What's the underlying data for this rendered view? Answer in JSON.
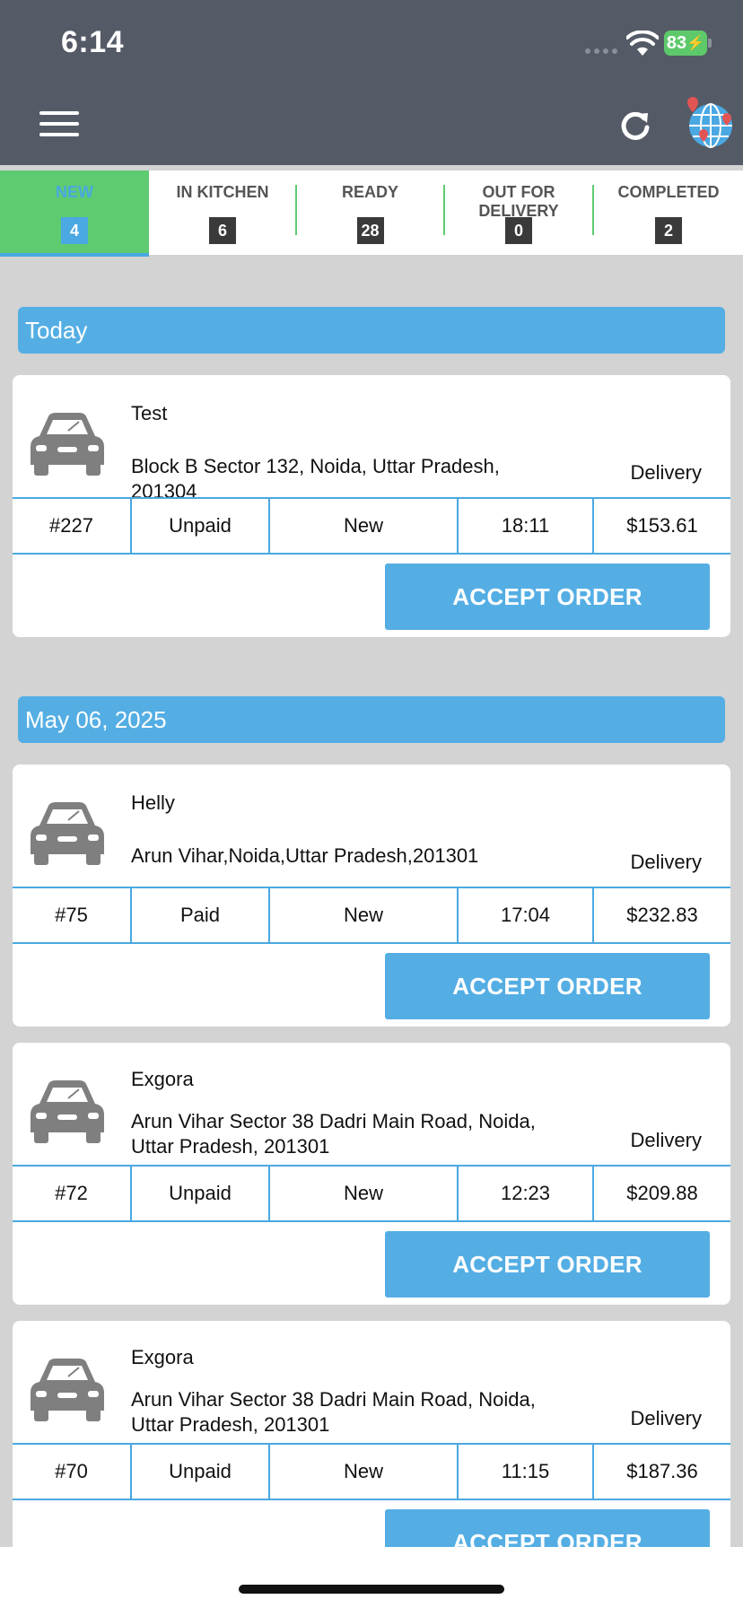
{
  "status_bar": {
    "time": "6:14",
    "battery": "83"
  },
  "header": {
    "menu_icon": "hamburger-menu-icon",
    "refresh_icon": "refresh-icon",
    "map_icon": "globe-pin-icon"
  },
  "tabs": [
    {
      "label": "NEW",
      "count": "4",
      "active": true
    },
    {
      "label": "IN KITCHEN",
      "count": "6"
    },
    {
      "label": "READY",
      "count": "28"
    },
    {
      "label": "OUT FOR DELIVERY",
      "count": "0"
    },
    {
      "label": "COMPLETED",
      "count": "2"
    }
  ],
  "sections": [
    {
      "date": "Today",
      "orders": [
        {
          "name": "Test",
          "address": "Block B Sector 132, Noida, Uttar Pradesh, 201304",
          "type": "Delivery",
          "id": "#227",
          "payment": "Unpaid",
          "status": "New",
          "time": "18:11",
          "total": "$153.61",
          "action": "ACCEPT ORDER"
        }
      ]
    },
    {
      "date": "May 06, 2025",
      "orders": [
        {
          "name": "Helly",
          "address": "Arun Vihar,Noida,Uttar Pradesh,201301",
          "type": "Delivery",
          "id": "#75",
          "payment": "Paid",
          "status": "New",
          "time": "17:04",
          "total": "$232.83",
          "action": "ACCEPT ORDER"
        },
        {
          "name": "Exgora",
          "address": "Arun Vihar Sector 38 Dadri Main Road, Noida, Uttar Pradesh, 201301",
          "type": "Delivery",
          "id": "#72",
          "payment": "Unpaid",
          "status": "New",
          "time": "12:23",
          "total": "$209.88",
          "action": "ACCEPT ORDER"
        },
        {
          "name": "Exgora",
          "address": "Arun Vihar Sector 38 Dadri Main Road, Noida, Uttar Pradesh, 201301",
          "type": "Delivery",
          "id": "#70",
          "payment": "Unpaid",
          "status": "New",
          "time": "11:15",
          "total": "$187.36",
          "action": "ACCEPT ORDER"
        }
      ]
    }
  ],
  "colors": {
    "header_bg": "#555b66",
    "accent_blue": "#54aee4",
    "active_tab_green": "#5ecb71",
    "page_bg": "#d3d3d3"
  }
}
